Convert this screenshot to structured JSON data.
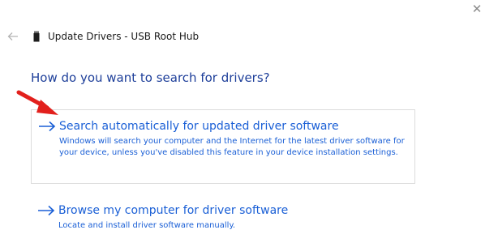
{
  "window": {
    "title": "Update Drivers - USB Root Hub",
    "close_glyph": "✕"
  },
  "icons": {
    "back": "back-arrow-icon",
    "device": "usb-device-icon",
    "option_arrow": "right-arrow-icon",
    "pointer": "red-pointer-arrow-icon"
  },
  "colors": {
    "heading": "#1e3f9a",
    "link": "#1a5fd6",
    "pointer": "#e2201c"
  },
  "heading": "How do you want to search for drivers?",
  "options": [
    {
      "title": "Search automatically for updated driver software",
      "description": "Windows will search your computer and the Internet for the latest driver software for your device, unless you've disabled this feature in your device installation settings."
    },
    {
      "title": "Browse my computer for driver software",
      "description": "Locate and install driver software manually."
    }
  ]
}
